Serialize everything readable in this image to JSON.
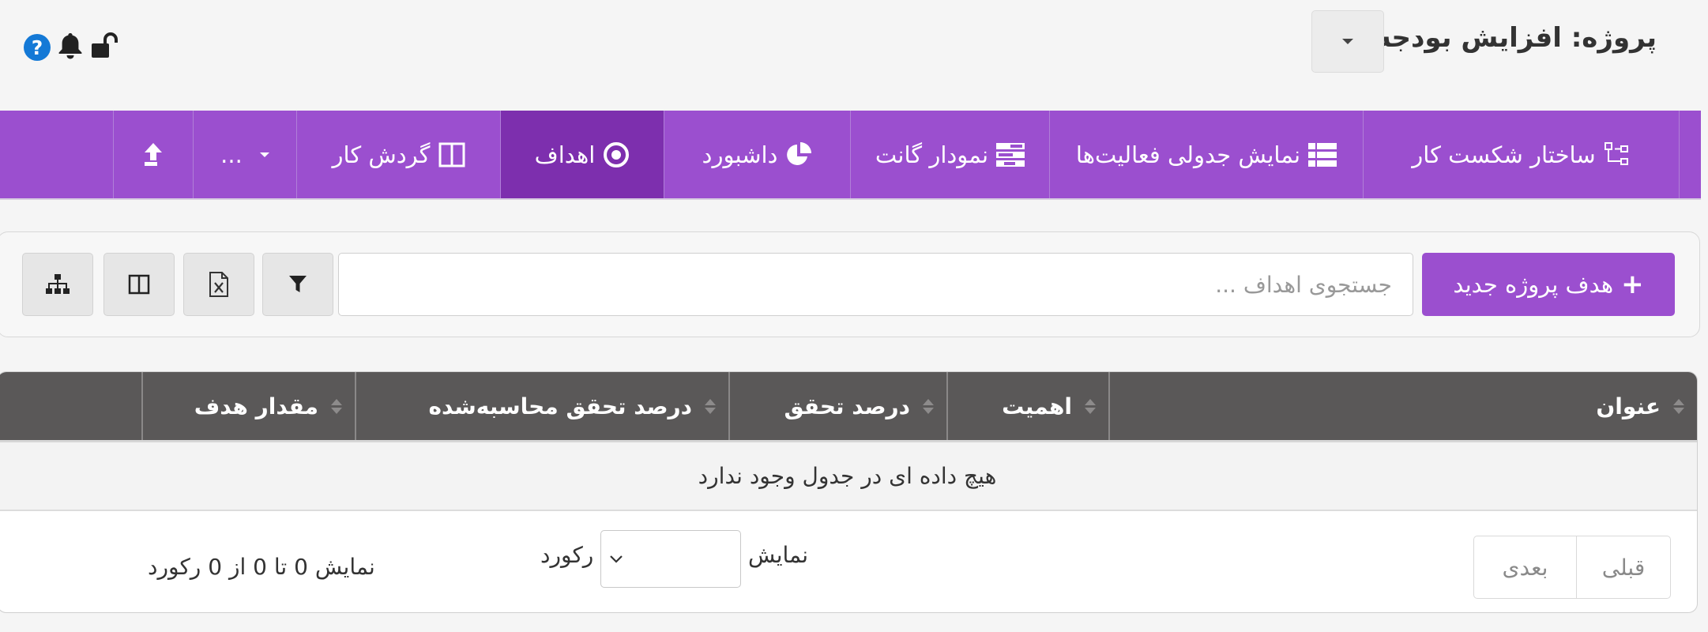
{
  "header": {
    "project_title": "پروژه: افزایش بودجه"
  },
  "nav": {
    "tabs": [
      {
        "label": "ساختار شکست کار",
        "icon": "sitemap-icon"
      },
      {
        "label": "نمایش جدولی فعالیت‌ها",
        "icon": "list-icon"
      },
      {
        "label": "نمودار گانت",
        "icon": "gantt-icon"
      },
      {
        "label": "داشبورد",
        "icon": "pie-chart-icon"
      },
      {
        "label": "اهداف",
        "icon": "target-icon",
        "active": true
      },
      {
        "label": "گردش کار",
        "icon": "columns-icon"
      },
      {
        "label": "...",
        "icon": "chevron-down-icon"
      },
      {
        "label": "",
        "icon": "upload-icon"
      }
    ]
  },
  "toolbar": {
    "new_goal_label": "هدف پروژه جدید",
    "search_placeholder": "جستجوی اهداف ...",
    "search_value": ""
  },
  "table": {
    "columns": [
      "عنوان",
      "اهمیت",
      "درصد تحقق",
      "درصد تحقق محاسبه‌شده",
      "مقدار هدف"
    ],
    "empty_message": "هیچ داده ای در جدول وجود ندارد"
  },
  "footer": {
    "info_text": "نمایش 0 تا 0 از 0 رکورد",
    "length_label_show": "نمایش",
    "length_label_record": "رکورد",
    "length_value": "",
    "prev_label": "قبلی",
    "next_label": "بعدی"
  },
  "colors": {
    "nav_purple": "#9b4fcf",
    "nav_active": "#7d2fae",
    "table_header": "#5a5858",
    "help_blue": "#1479d6"
  }
}
